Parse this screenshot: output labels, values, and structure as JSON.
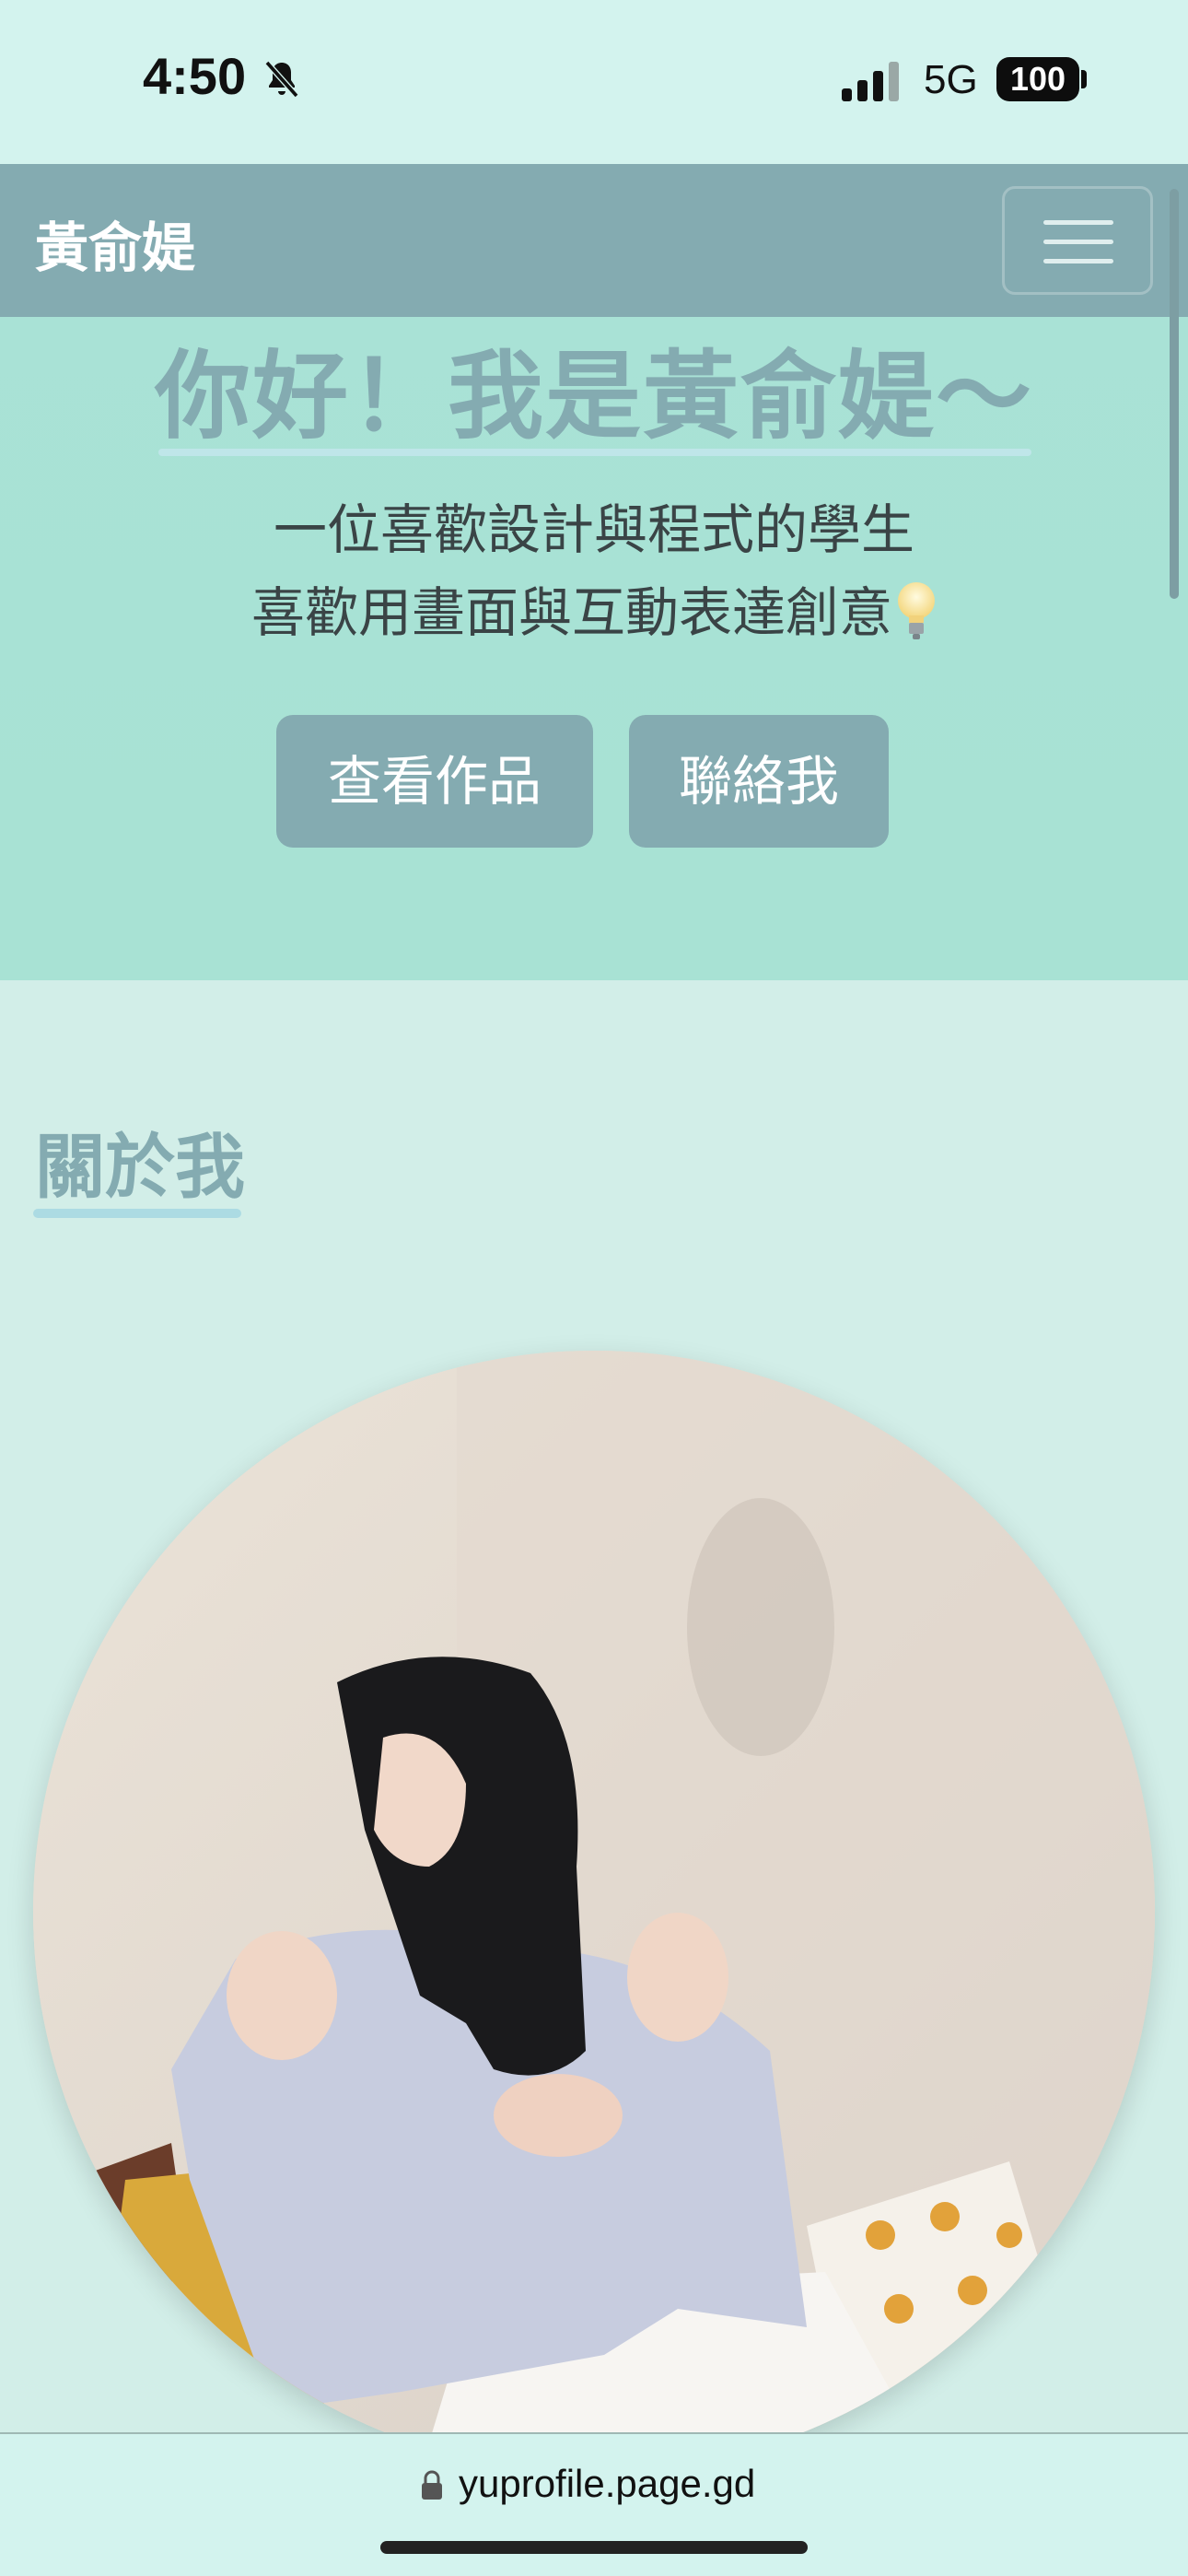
{
  "status_bar": {
    "time": "4:50",
    "network": "5G",
    "battery": "100"
  },
  "navbar": {
    "brand": "黃俞媞"
  },
  "hero": {
    "title": "你好！我是黃俞媞～",
    "subtitle_line1": "一位喜歡設計與程式的學生",
    "subtitle_line2": "喜歡用畫面與互動表達創意",
    "works_button": "查看作品",
    "contact_button": "聯絡我"
  },
  "about": {
    "heading": "關於我"
  },
  "browser": {
    "url": "yuprofile.page.gd"
  },
  "colors": {
    "accent": "#84abb1",
    "hero_bg": "#a9e2d6",
    "page_bg": "#d2eee8"
  },
  "icons": [
    "bell-slash-icon",
    "signal-icon",
    "battery-icon",
    "menu-icon",
    "lightbulb-icon",
    "lock-icon"
  ]
}
